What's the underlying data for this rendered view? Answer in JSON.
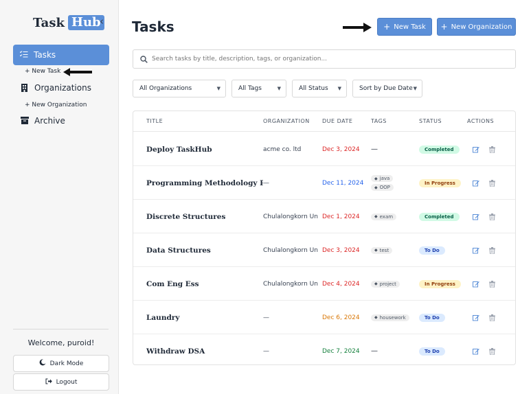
{
  "sidebar": {
    "brand_task": "Task",
    "brand_hub": "Hub",
    "collapse_glyph": "‹",
    "tasks_label": "Tasks",
    "new_task_label": "+ New Task",
    "organizations_label": "Organizations",
    "new_org_label": "+ New Organization",
    "archive_label": "Archive",
    "welcome": "Welcome, puroid!",
    "dark_mode_label": "Dark Mode",
    "logout_label": "Logout"
  },
  "header": {
    "title": "Tasks",
    "new_task_button": "New Task",
    "new_org_button": "New Organization"
  },
  "search": {
    "placeholder": "Search tasks by title, description, tags, or organization..."
  },
  "filters": {
    "organizations": "All Organizations",
    "tags": "All Tags",
    "status": "All Status",
    "sort": "Sort by Due Date"
  },
  "table": {
    "headers": [
      "TITLE",
      "ORGANIZATION",
      "DUE DATE",
      "TAGS",
      "STATUS",
      "ACTIONS"
    ],
    "rows": [
      {
        "title": "Deploy TaskHub",
        "organization": "acme co. ltd",
        "due": "Dec 3, 2024",
        "due_color": "#dc2626",
        "tags": [],
        "status": "Completed"
      },
      {
        "title": "Programming Methodology Pr",
        "organization": "—",
        "due": "Dec 11, 2024",
        "due_color": "#2563eb",
        "tags": [
          "java",
          "OOP"
        ],
        "status": "In Progress"
      },
      {
        "title": "Discrete Structures",
        "organization": "Chulalongkorn Un",
        "due": "Dec 1, 2024",
        "due_color": "#dc2626",
        "tags": [
          "exam"
        ],
        "status": "Completed"
      },
      {
        "title": "Data Structures",
        "organization": "Chulalongkorn Un",
        "due": "Dec 3, 2024",
        "due_color": "#dc2626",
        "tags": [
          "test"
        ],
        "status": "To Do"
      },
      {
        "title": "Com Eng Ess",
        "organization": "Chulalongkorn Un",
        "due": "Dec 4, 2024",
        "due_color": "#dc2626",
        "tags": [
          "project"
        ],
        "status": "In Progress"
      },
      {
        "title": "Laundry",
        "organization": "—",
        "due": "Dec 6, 2024",
        "due_color": "#d97706",
        "tags": [
          "housework"
        ],
        "status": "To Do"
      },
      {
        "title": "Withdraw DSA",
        "organization": "—",
        "due": "Dec 7, 2024",
        "due_color": "#15803d",
        "tags": [],
        "status": "To Do"
      }
    ],
    "empty_tags": "—"
  },
  "status_colors": {
    "Completed": {
      "bg": "#d1fae5",
      "fg": "#065f46"
    },
    "In Progress": {
      "bg": "#fef3c7",
      "fg": "#92400e"
    },
    "To Do": {
      "bg": "#dbeafe",
      "fg": "#1e40af"
    }
  },
  "colors": {
    "accent": "#5b8fd8",
    "action_icon": "#5b8fd8",
    "delete_icon": "#9ca3af"
  },
  "icons": {
    "tasks": "list-check-icon",
    "organizations": "building-icon",
    "archive": "archive-box-icon",
    "search": "search-icon",
    "dark_mode": "moon-icon",
    "logout": "logout-icon",
    "edit": "edit-icon",
    "delete": "trash-icon",
    "tag": "tag-icon"
  }
}
